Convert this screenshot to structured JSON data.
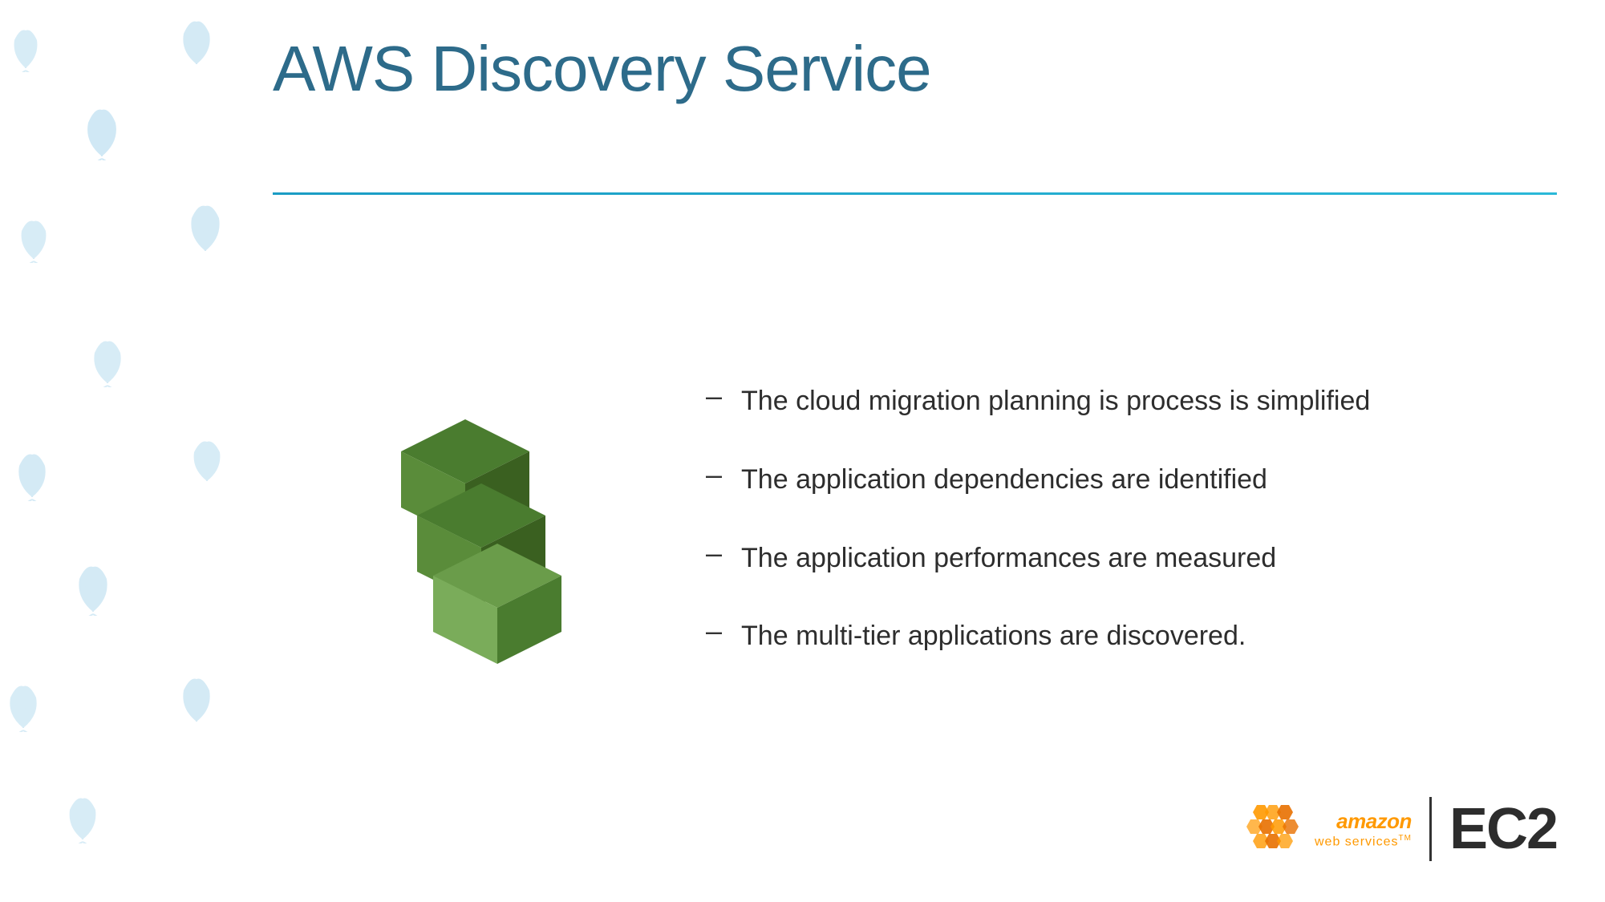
{
  "slide": {
    "title": "AWS Discovery Service",
    "divider_color": "#1a9cc4",
    "bullets": [
      {
        "id": "bullet-1",
        "text": "The cloud migration planning is process is simplified"
      },
      {
        "id": "bullet-2",
        "text": "The application dependencies are identified"
      },
      {
        "id": "bullet-3",
        "text": "The application performances are measured"
      },
      {
        "id": "bullet-4",
        "text": "The multi-tier applications are discovered."
      }
    ],
    "aws_logo": {
      "amazon_label": "amazon",
      "webservices_label": "web services",
      "ec2_label": "EC2"
    }
  },
  "icons": {
    "bullet_dash": "–",
    "leaf_color": "#b8ddf0"
  }
}
